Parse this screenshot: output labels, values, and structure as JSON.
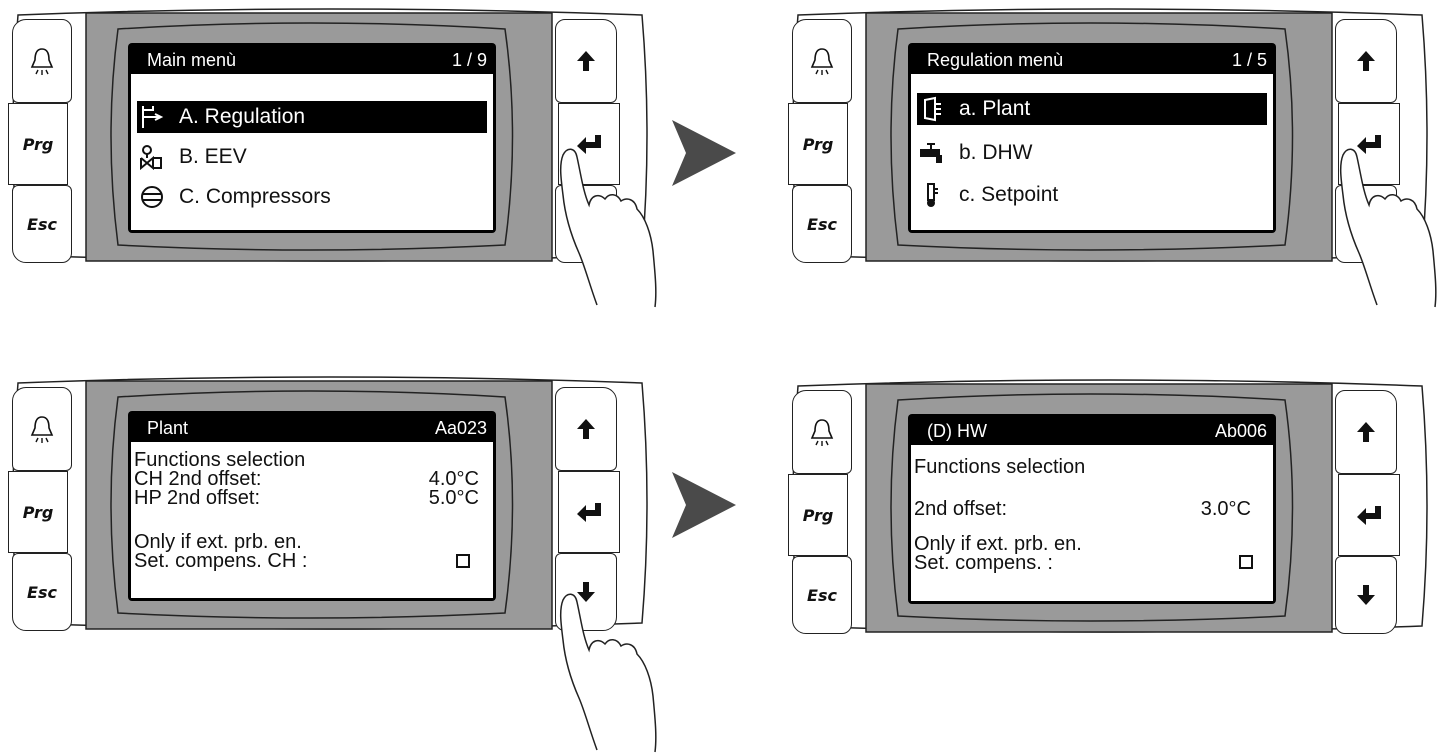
{
  "colors": {
    "bezel": "#9a9a9a",
    "outline": "#222222",
    "arrow": "#4a4a4a",
    "lcd_inverse": "#000000"
  },
  "keys": {
    "prg": "Prg",
    "esc": "Esc",
    "alarm_icon": "bell-icon",
    "up_icon": "arrow-up-icon",
    "enter_icon": "enter-icon",
    "down_icon": "arrow-down-icon"
  },
  "panel1": {
    "header": {
      "title": "Main menù",
      "counter": "1 / 9"
    },
    "items": [
      {
        "label": "A. Regulation",
        "icon": "regulation-icon",
        "selected": true
      },
      {
        "label": "B. EEV",
        "icon": "valve-icon",
        "selected": false
      },
      {
        "label": "C. Compressors",
        "icon": "compressor-icon",
        "selected": false
      }
    ]
  },
  "panel2": {
    "header": {
      "title": "Regulation menù",
      "counter": "1 / 5"
    },
    "items": [
      {
        "label": "a. Plant",
        "icon": "plant-icon",
        "selected": true
      },
      {
        "label": "b. DHW",
        "icon": "faucet-icon",
        "selected": false
      },
      {
        "label": "c. Setpoint",
        "icon": "thermometer-icon",
        "selected": false
      }
    ]
  },
  "panel3": {
    "header": {
      "title": "Plant",
      "code": "Aa023"
    },
    "section": "Functions selection",
    "rows": [
      {
        "label": "CH 2nd offset:",
        "value": "4.0°C"
      },
      {
        "label": "HP 2nd offset:",
        "value": "5.0°C"
      }
    ],
    "note": "Only if ext. prb. en.",
    "check_label": "Set. compens. CH :",
    "check_checked": false
  },
  "panel4": {
    "header": {
      "title": "(D) HW",
      "code": "Ab006"
    },
    "section": "Functions selection",
    "rows": [
      {
        "label": "2nd offset:",
        "value": "3.0°C"
      }
    ],
    "note": "Only if ext. prb. en.",
    "check_label": "Set. compens. :",
    "check_checked": false
  }
}
